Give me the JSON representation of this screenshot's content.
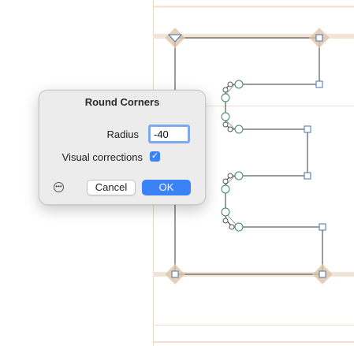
{
  "dialog": {
    "title": "Round Corners",
    "radius_label": "Radius",
    "radius_value": "-40",
    "visual_corrections_label": "Visual corrections",
    "visual_corrections_checked": true,
    "cancel_label": "Cancel",
    "ok_label": "OK",
    "more_icon": "ellipsis-circle-icon",
    "checkmark_icon": "checkmark-icon"
  },
  "colors": {
    "guide_line": "#f0dfcf",
    "path_stroke": "#3a3a3a",
    "node_square": "#4a6fb0",
    "node_circle": "#3a8a5a",
    "diamond_fill": "#ddc4a4",
    "accent_blue": "#3b82f6"
  }
}
